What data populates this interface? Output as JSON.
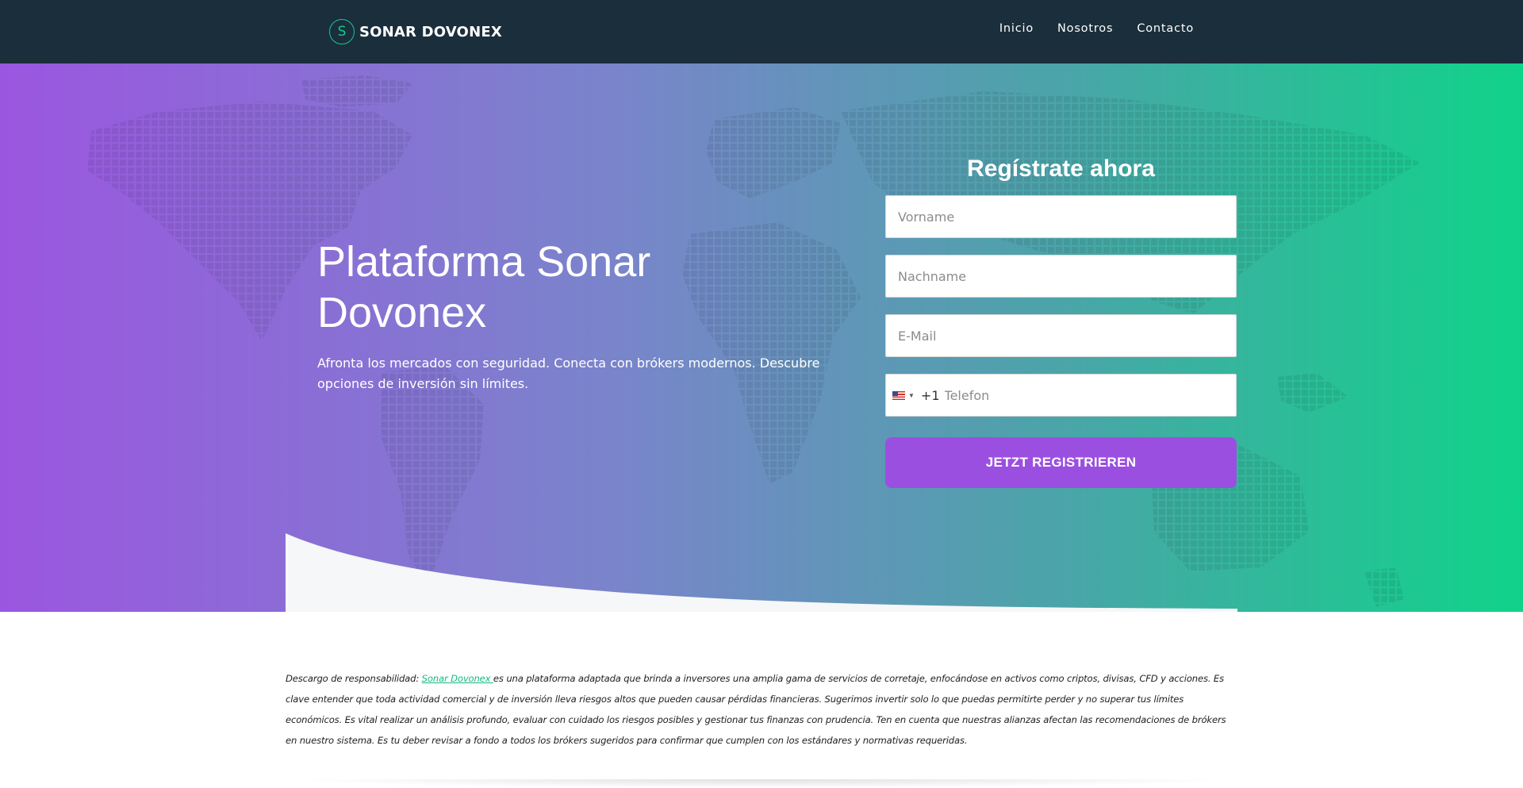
{
  "brand": {
    "logo_letter": "S",
    "name": "SONAR DOVONEX"
  },
  "nav": {
    "items": [
      "Inicio",
      "Nosotros",
      "Contacto"
    ]
  },
  "hero": {
    "title": "Plataforma Sonar Dovonex",
    "subtitle": "Afronta los mercados con seguridad. Conecta con brókers modernos. Descubre opciones de inversión sin límites."
  },
  "form": {
    "title": "Regístrate ahora",
    "first_name_placeholder": "Vorname",
    "last_name_placeholder": "Nachname",
    "email_placeholder": "E-Mail",
    "phone_dial_code": "+1",
    "phone_placeholder": "Telefon",
    "submit_label": "JETZT REGISTRIEREN"
  },
  "disclaimer": {
    "prefix": "Descargo de responsabilidad: ",
    "link_text": "Sonar Dovonex ",
    "body": "es una plataforma adaptada que brinda a inversores una amplia gama de servicios de corretaje, enfocándose en activos como criptos, divisas, CFD y acciones. Es clave entender que toda actividad comercial y de inversión lleva riesgos altos que pueden causar pérdidas financieras. Sugerimos invertir solo lo que puedas permitirte perder y no superar tus límites económicos. Es vital realizar un análisis profundo, evaluar con cuidado los riesgos posibles y gestionar tus finanzas con prudencia. Ten en cuenta que nuestras alianzas afectan las recomendaciones de brókers en nuestro sistema. Es tu deber revisar a fondo a todos los brókers sugeridos para confirmar que cumplen con los estándares y normativas requeridas."
  },
  "colors": {
    "navbar": "#1a2e3b",
    "accent_green": "#18c98f",
    "gradient_start": "#9b56e0",
    "gradient_end": "#10d38a",
    "button": "#9b4fe0"
  },
  "icons": {
    "phone_country_flag": "us-flag-icon"
  }
}
